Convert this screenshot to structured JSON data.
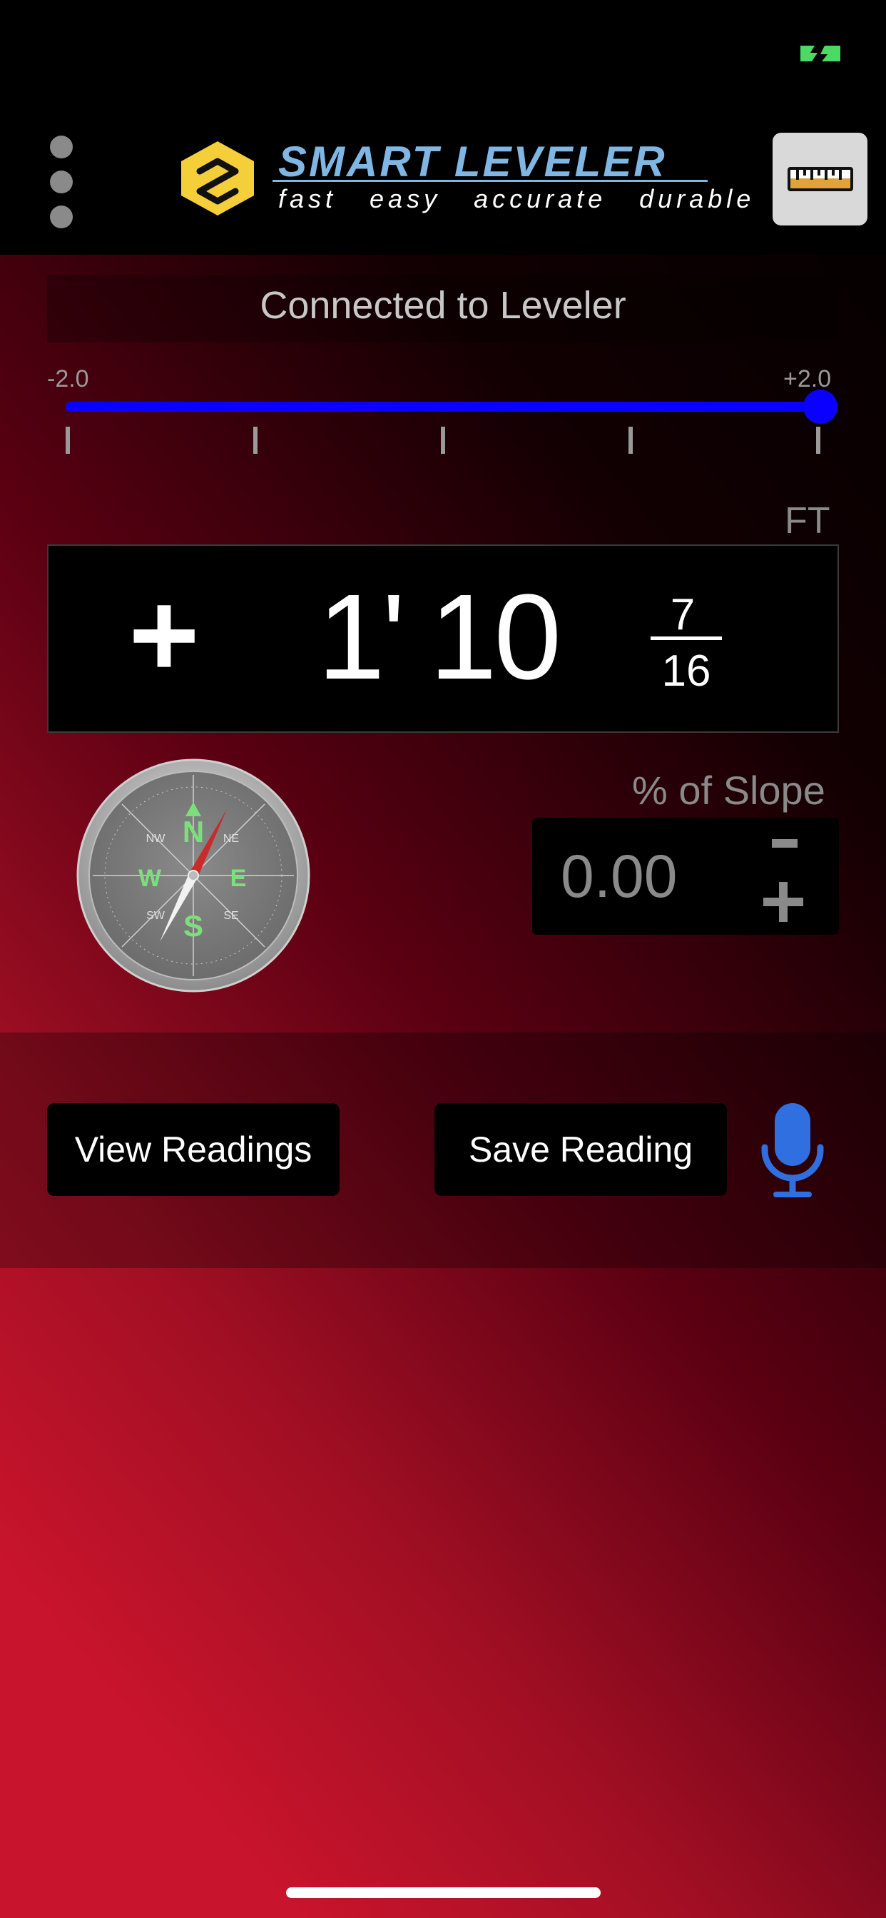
{
  "header": {
    "brand_title": "SMART LEVELER",
    "brand_tagline": "fast easy accurate durable",
    "menu_icon": "more-vertical-icon",
    "ruler_icon": "ruler-icon"
  },
  "connection": {
    "status_text": "Connected to Leveler"
  },
  "slider": {
    "min_label": "-2.0",
    "max_label": "+2.0",
    "value": 2.0,
    "tick_count": 5
  },
  "measurement": {
    "unit": "FT",
    "sign": "+",
    "feet": "1'",
    "inches": "10",
    "fraction_numerator": "7",
    "fraction_denominator": "16"
  },
  "slope": {
    "label": "% of Slope",
    "value": "0.00"
  },
  "compass": {
    "icon": "compass-icon",
    "cardinals": {
      "n": "N",
      "e": "E",
      "s": "S",
      "w": "W"
    },
    "intercardinals": {
      "ne": "NE",
      "se": "SE",
      "sw": "SW",
      "nw": "NW"
    }
  },
  "actions": {
    "view_readings": "View Readings",
    "save_reading": "Save Reading",
    "mic_icon": "microphone-icon"
  },
  "colors": {
    "slider_blue": "#0a00ff",
    "mic_blue": "#2f6fe0",
    "logo_blue": "#7fb6e3",
    "logo_yellow": "#f4cf3a",
    "battery_green": "#4cd964"
  }
}
